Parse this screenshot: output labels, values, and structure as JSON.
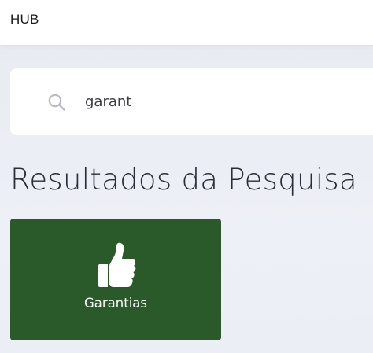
{
  "header": {
    "brand": "HUB"
  },
  "search": {
    "value": "garant",
    "icon": "search-icon"
  },
  "results": {
    "title": "Resultados da Pesquisa",
    "cards": [
      {
        "label": "Garantias",
        "icon": "thumbs-up-icon",
        "color": "#2a5a2a"
      }
    ]
  },
  "colors": {
    "background": "#eceef6",
    "header_background": "#ffffff",
    "card_background": "#2a5a2a",
    "card_text": "#ffffff"
  }
}
